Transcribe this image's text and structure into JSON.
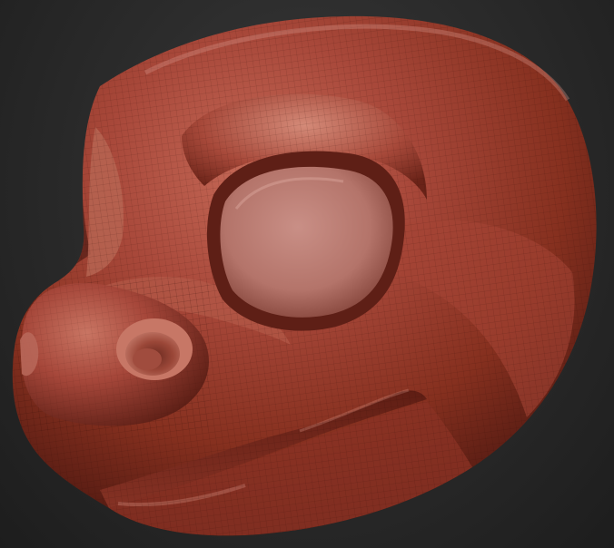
{
  "scene": {
    "subject": "3d-sculpt-creature-head",
    "material_color": "#9a3b2c",
    "highlight_color": "#d08a7c",
    "shadow_color": "#4a1610",
    "background_color": "#232323"
  }
}
